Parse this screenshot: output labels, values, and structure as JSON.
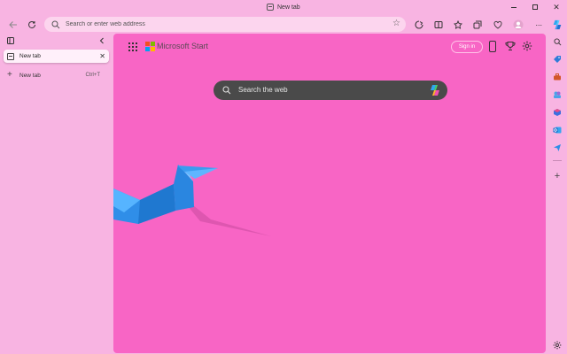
{
  "window": {
    "title": "New tab"
  },
  "toolbar": {
    "address_placeholder": "Search or enter web address"
  },
  "tabs": {
    "items": [
      {
        "label": "New tab",
        "active": true
      }
    ],
    "new_tab_label": "New tab",
    "new_tab_shortcut": "Ctrl+T"
  },
  "page": {
    "brand": "Microsoft Start",
    "sign_in_label": "Sign in",
    "search_placeholder": "Search the web"
  },
  "colors": {
    "chrome_background": "#f8b4e2",
    "page_background": "#f865c5",
    "search_bar": "#4a4a4a",
    "ms_logo": [
      "#f25022",
      "#7fba00",
      "#00a4ef",
      "#ffb900"
    ]
  },
  "icons": {
    "toolbar": [
      "back-icon",
      "refresh-icon",
      "search-icon",
      "favorite-star-icon",
      "split-screen-icon",
      "favorites-icon",
      "collections-icon",
      "browser-essentials-icon",
      "profile-icon",
      "more-icon",
      "copilot-icon"
    ],
    "right_sidebar": [
      "copilot-icon",
      "search-icon",
      "shopping-icon",
      "tools-icon",
      "games-icon",
      "office-icon",
      "outlook-icon",
      "send-icon",
      "add-icon",
      "settings-icon"
    ]
  }
}
